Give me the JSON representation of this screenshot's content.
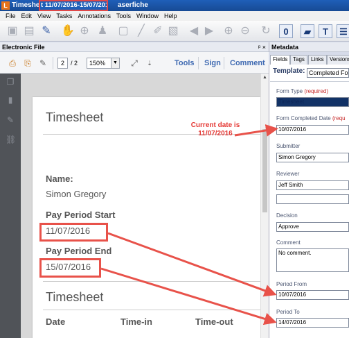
{
  "titlebar": {
    "title_prefix": "Timeshe",
    "title_highlight": "t 11/07/2016-15/07/2016 -",
    "title_suffix": "aserfiche",
    "app_icon": "L"
  },
  "menu": [
    "File",
    "Edit",
    "View",
    "Tasks",
    "Annotations",
    "Tools",
    "Window",
    "Help"
  ],
  "left_panel": {
    "header": "Electronic File",
    "pin": "p ×",
    "page_current": "2",
    "page_total": "/ 2",
    "zoom": "150%",
    "tabs": [
      "Tools",
      "Sign",
      "Comment"
    ]
  },
  "document": {
    "title": "Timesheet",
    "name_label": "Name:",
    "name_value": "Simon Gregory",
    "start_label": "Pay Period Start",
    "start_value": "11/07/2016",
    "end_label": "Pay Period End",
    "end_value": "15/07/2016",
    "section2_title": "Timesheet",
    "col_date": "Date",
    "col_timein": "Time-in",
    "col_timeout": "Time-out"
  },
  "annotation": {
    "text": "Current date is 11/07/2016",
    "color": "#e53935"
  },
  "metadata": {
    "header": "Metadata",
    "tabs": [
      "Fields",
      "Tags",
      "Links",
      "Versions"
    ],
    "template_label": "Template:",
    "template_value": "Completed For",
    "form_type_label": "Form Type",
    "form_type_req": "(required)",
    "form_type_value": "Timesheet",
    "completed_label": "Form Completed Date",
    "completed_req": "(requ",
    "completed_value": "10/07/2016",
    "submitter_label": "Submitter",
    "submitter_value": "Simon Gregory",
    "reviewer_label": "Reviewer",
    "reviewer_value": "Jeff Smith",
    "reviewer2_value": "",
    "decision_label": "Decision",
    "decision_value": "Approve",
    "comment_label": "Comment",
    "comment_value": "No comment.",
    "period_from_label": "Period From",
    "period_from_value": "10/07/2016",
    "period_to_label": "Period To",
    "period_to_value": "14/07/2016"
  },
  "colors": {
    "highlight": "#e8524a",
    "accent": "#3f6ab2"
  }
}
